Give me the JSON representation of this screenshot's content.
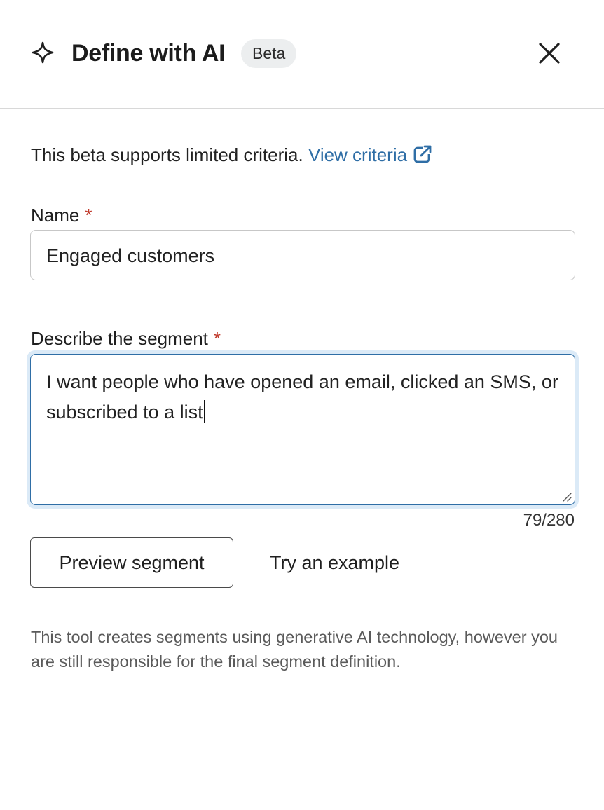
{
  "header": {
    "title": "Define with AI",
    "badge": "Beta",
    "icons": {
      "sparkle": "sparkle-icon",
      "close": "close-icon"
    }
  },
  "intro": {
    "text": "This beta supports limited criteria.",
    "link_label": "View criteria",
    "link_icon": "external-link-icon",
    "link_color": "#2f6ea6"
  },
  "name_field": {
    "label": "Name",
    "required_marker": "*",
    "value": "Engaged customers"
  },
  "description_field": {
    "label": "Describe the segment",
    "required_marker": "*",
    "value": "I want people who have opened an email, clicked an SMS, or subscribed to a list",
    "counter": "79/280",
    "focused": true
  },
  "actions": {
    "preview_label": "Preview segment",
    "example_label": "Try an example"
  },
  "disclaimer": "This tool creates segments using generative AI technology, however you are still responsible for the final segment definition.",
  "colors": {
    "required": "#c0392b",
    "focus_border": "#2f6ea6",
    "focus_ring": "#dbeaf7",
    "badge_bg": "#eceeef"
  }
}
